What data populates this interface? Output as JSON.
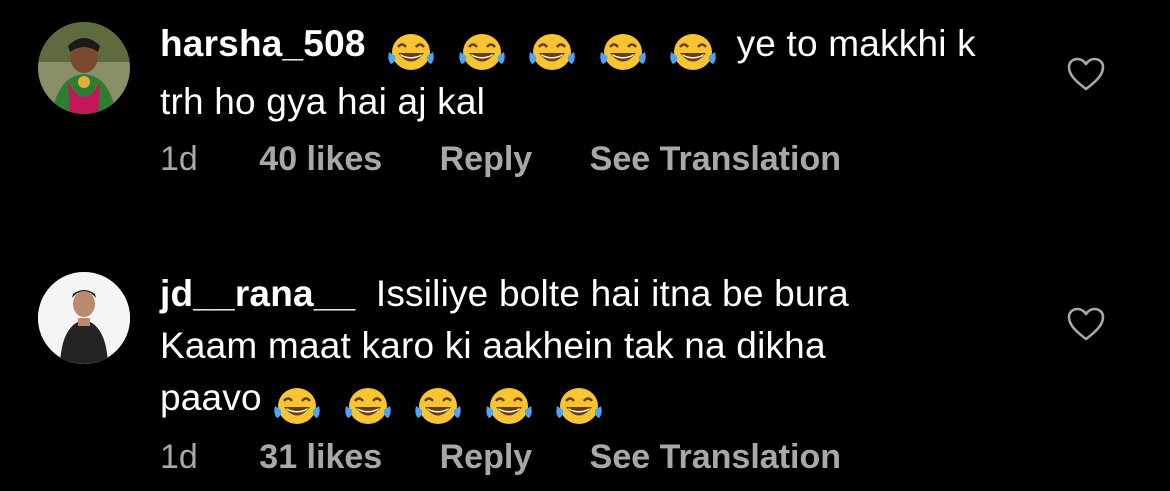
{
  "comments": [
    {
      "username": "harsha_508",
      "emoji_count": 5,
      "text_line1": "ye to makkhi k",
      "text_line2": "trh ho gya hai aj kal",
      "time": "1d",
      "likes": "40 likes",
      "reply": "Reply",
      "translate": "See Translation",
      "avatar_colors": [
        "#6b8a3a",
        "#c2185b"
      ]
    },
    {
      "username": "jd__rana__",
      "emoji_count": 5,
      "text_line1": "Issiliye bolte hai itna be bura",
      "text_line2": "Kaam maat karo ki aakhein tak na dikha",
      "text_line3": "paavo",
      "time": "1d",
      "likes": "31 likes",
      "reply": "Reply",
      "translate": "See Translation",
      "avatar_colors": [
        "#e6e6e6",
        "#2b2b2b"
      ]
    }
  ],
  "icons": {
    "emoji": "face-with-tears-of-joy-icon",
    "like": "heart-outline-icon"
  },
  "colors": {
    "background": "#000000",
    "text": "#ffffff",
    "meta": "#a8a8a8",
    "emoji_face": "#f7c532"
  }
}
